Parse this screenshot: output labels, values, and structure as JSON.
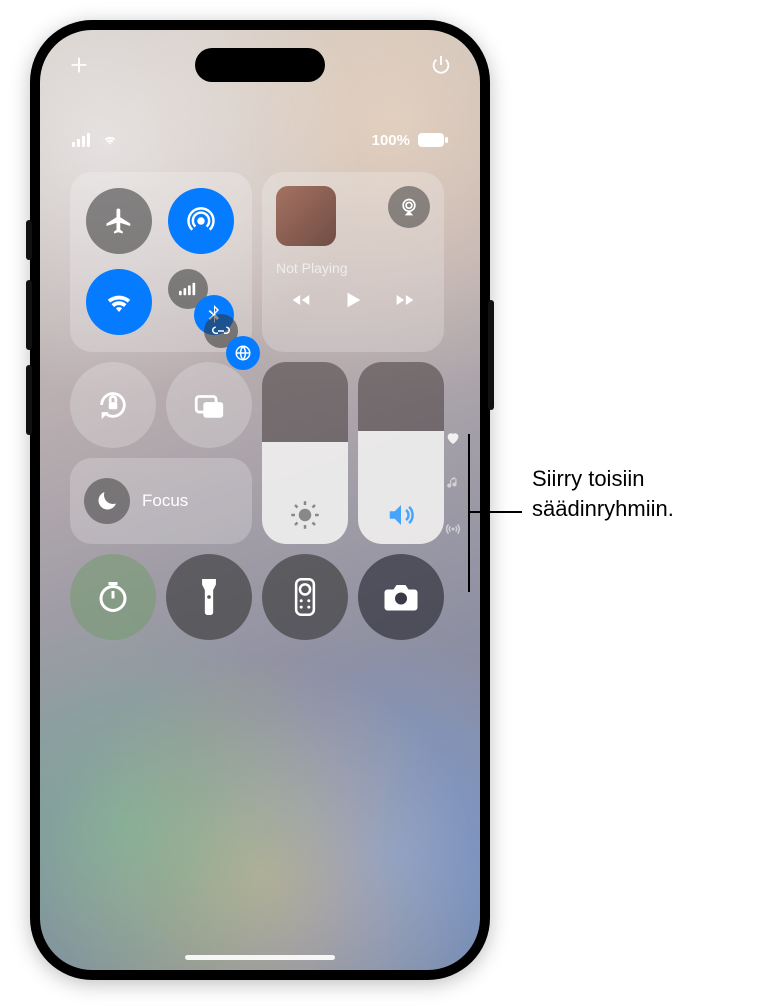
{
  "topbar": {
    "add_icon": "plus-icon",
    "power_icon": "power-icon"
  },
  "status": {
    "cellular_icon": "cellular-bars-icon",
    "wifi_icon": "wifi-icon",
    "battery_percent": "100%",
    "battery_icon": "battery-icon"
  },
  "connectivity": {
    "airplane": {
      "label": "airplane-mode",
      "on": false
    },
    "airdrop": {
      "label": "airdrop",
      "on": true
    },
    "wifi": {
      "label": "wifi",
      "on": true
    },
    "cellular_bluetooth": {
      "label": "cellular-bluetooth-cluster"
    },
    "satellite_hotspot": {
      "label": "satellite-hotspot-cluster"
    }
  },
  "media": {
    "title": "Not Playing",
    "back_icon": "rewind-icon",
    "play_icon": "play-icon",
    "fwd_icon": "fast-forward-icon",
    "airplay_icon": "airplay-icon"
  },
  "tiles": {
    "orientation_lock": "orientation-lock",
    "screen_mirroring": "screen-mirroring",
    "focus_label": "Focus",
    "brightness": {
      "level_pct": 56,
      "icon": "brightness-icon"
    },
    "volume": {
      "level_pct": 62,
      "icon": "volume-icon"
    },
    "timer": "timer",
    "flashlight": "flashlight",
    "remote": "apple-tv-remote",
    "camera": "camera"
  },
  "page_dots": {
    "items": [
      "heart-icon",
      "music-note-icon",
      "broadcast-icon"
    ],
    "active_index": 0
  },
  "callout": {
    "text": "Siirry toisiin säädinryhmiin."
  }
}
